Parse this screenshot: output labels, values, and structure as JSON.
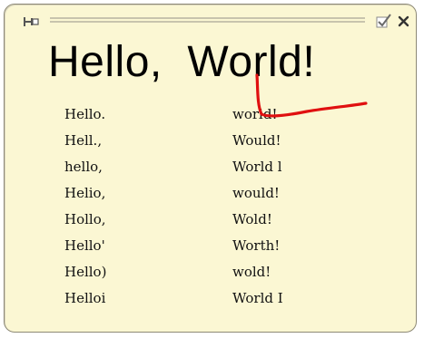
{
  "note": {
    "heading": "Hello,  World!",
    "pin_icon": "pin-icon",
    "check_icon": "check-icon",
    "close_icon": "close-icon",
    "rows": [
      [
        "Hello.",
        "world!"
      ],
      [
        "Hell.,",
        "Would!"
      ],
      [
        "hello,",
        "World l"
      ],
      [
        "Helio,",
        "would!"
      ],
      [
        "Hollo,",
        "Wold!"
      ],
      [
        "Hello'",
        "Worth!"
      ],
      [
        "Hello)",
        "wold!"
      ],
      [
        "Helloi",
        "World I"
      ]
    ],
    "colors": {
      "background": "#fbf7d3",
      "border": "#8e8a76",
      "mark": "#e01010"
    }
  }
}
